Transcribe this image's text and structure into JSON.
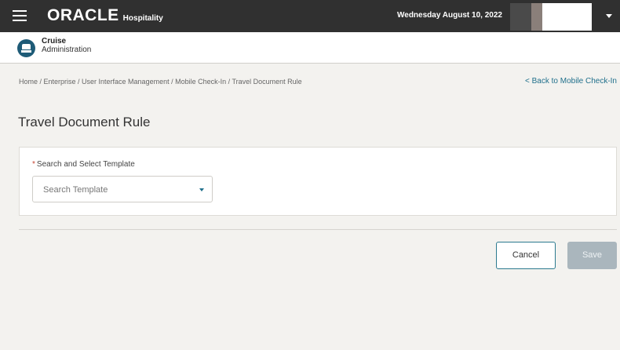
{
  "topbar": {
    "brand_name": "ORACLE",
    "brand_sub": "Hospitality",
    "date": "Wednesday August 10, 2022"
  },
  "app": {
    "title_line1": "Cruise",
    "title_line2": "Administration"
  },
  "breadcrumb": "Home / Enterprise / User Interface Management / Mobile Check-In / Travel Document Rule",
  "back_link": "< Back to Mobile Check-In",
  "page_title": "Travel Document Rule",
  "form": {
    "required_mark": "*",
    "template_label": "Search and Select Template",
    "template_placeholder": "Search Template"
  },
  "buttons": {
    "cancel": "Cancel",
    "save": "Save"
  },
  "colors": {
    "topbar": "#303030",
    "accent": "#1f6f8b",
    "required": "#c74634",
    "save_disabled": "#aab6bd"
  }
}
